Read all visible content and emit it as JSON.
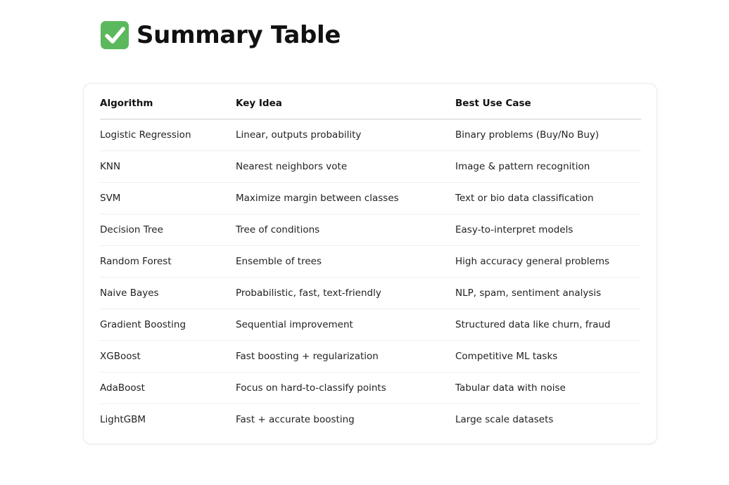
{
  "page": {
    "title": "Summary Table",
    "title_icon": "check-mark-icon",
    "accent_color": "#5cb85c"
  },
  "table": {
    "headers": [
      "Algorithm",
      "Key Idea",
      "Best Use Case"
    ],
    "rows": [
      [
        "Logistic Regression",
        "Linear, outputs probability",
        "Binary problems (Buy/No Buy)"
      ],
      [
        "KNN",
        "Nearest neighbors vote",
        "Image & pattern recognition"
      ],
      [
        "SVM",
        "Maximize margin between classes",
        "Text or bio data classification"
      ],
      [
        "Decision Tree",
        "Tree of conditions",
        "Easy-to-interpret models"
      ],
      [
        "Random Forest",
        "Ensemble of trees",
        "High accuracy general problems"
      ],
      [
        "Naive Bayes",
        "Probabilistic, fast, text-friendly",
        "NLP, spam, sentiment analysis"
      ],
      [
        "Gradient Boosting",
        "Sequential improvement",
        "Structured data like churn, fraud"
      ],
      [
        "XGBoost",
        "Fast boosting + regularization",
        "Competitive ML tasks"
      ],
      [
        "AdaBoost",
        "Focus on hard-to-classify points",
        "Tabular data with noise"
      ],
      [
        "LightGBM",
        "Fast + accurate boosting",
        "Large scale datasets"
      ]
    ]
  }
}
